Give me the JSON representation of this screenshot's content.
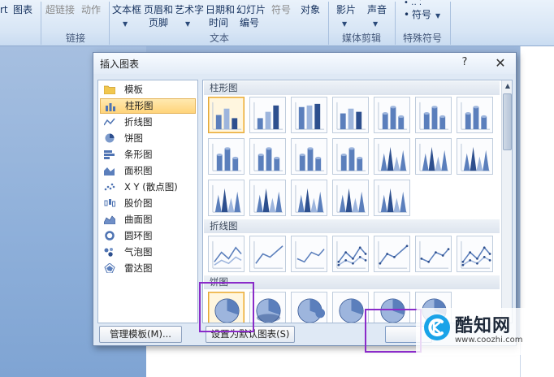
{
  "ribbon": {
    "buttons": {
      "art_fragment": "rt",
      "tubiao": "图表",
      "chaolianjie": "超链接",
      "dongzuo": "动作",
      "wenbenkuang": "文本框",
      "yemeiheyejiao_line1": "页眉和",
      "yemeiheyejiao_line2": "页脚",
      "yishuzi": "艺术字",
      "riqishijian_line1": "日期和",
      "riqishijian_line2": "时间",
      "huandengpian_line1": "幻灯片",
      "huandengpian_line2": "编号",
      "fuhao_disabled": "符号",
      "duixiang": "对象",
      "yingpian": "影片",
      "shengyin": "声音",
      "fuhao": "符号"
    },
    "groups": {
      "lianjie": "链接",
      "wenben": "文本",
      "meitijianji": "媒体剪辑",
      "teshufuhao": "特殊符号"
    }
  },
  "dialog": {
    "title": "插入图表",
    "help": "?",
    "close": "✕",
    "categories": [
      {
        "label": "模板",
        "icon": "folder-icon"
      },
      {
        "label": "柱形图",
        "icon": "column-chart-icon",
        "selected": true
      },
      {
        "label": "折线图",
        "icon": "line-chart-icon"
      },
      {
        "label": "饼图",
        "icon": "pie-chart-icon"
      },
      {
        "label": "条形图",
        "icon": "bar-chart-icon"
      },
      {
        "label": "面积图",
        "icon": "area-chart-icon"
      },
      {
        "label": "X Y (散点图)",
        "icon": "scatter-chart-icon"
      },
      {
        "label": "股价图",
        "icon": "stock-chart-icon"
      },
      {
        "label": "曲面图",
        "icon": "surface-chart-icon"
      },
      {
        "label": "圆环图",
        "icon": "doughnut-chart-icon"
      },
      {
        "label": "气泡图",
        "icon": "bubble-chart-icon"
      },
      {
        "label": "雷达图",
        "icon": "radar-chart-icon"
      }
    ],
    "sections": {
      "column": "柱形图",
      "line": "折线图",
      "pie": "饼图"
    },
    "manage_templates": "管理模板(M)...",
    "set_default": "设置为默认图表(S)"
  },
  "watermark": {
    "name": "酷知网",
    "url": "www.coozhi.com"
  },
  "colors": {
    "accent_purple": "#8a2bc9",
    "selection_orange": "#ffd47a",
    "chart_blue": "#4f74b3"
  }
}
